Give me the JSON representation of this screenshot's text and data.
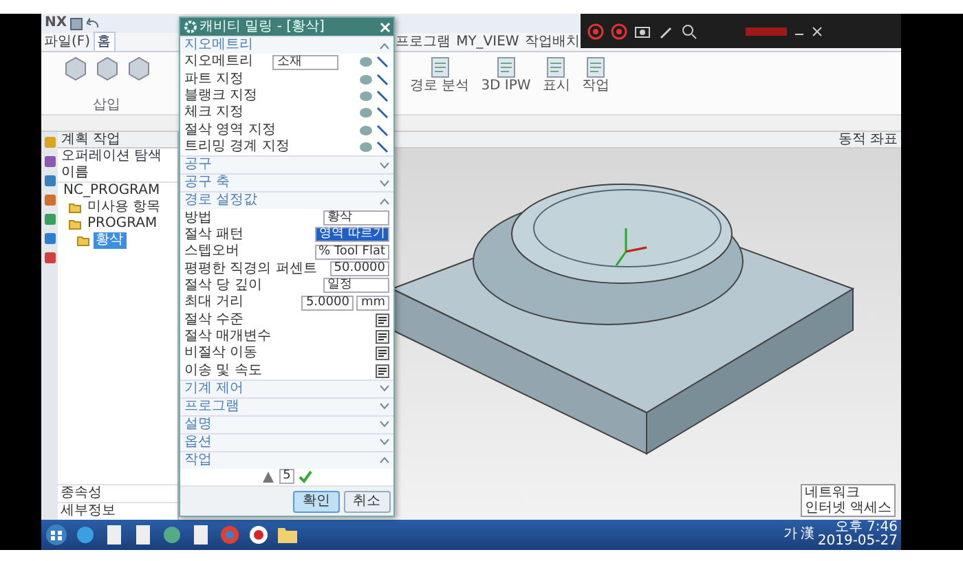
{
  "app": {
    "logo": "NX"
  },
  "ribbon": {
    "tabs": [
      {
        "label": "파일(F)",
        "selected": false
      },
      {
        "label": "홈",
        "selected": true
      },
      {
        "label": "프로그램",
        "selected": false
      },
      {
        "label": "MY_VIEW",
        "selected": false
      },
      {
        "label": "작업배치",
        "selected": false
      }
    ],
    "left_group": "삽입",
    "right_buttons": [
      {
        "label": "경로 분석"
      },
      {
        "label": "3D IPW"
      },
      {
        "label": "표시"
      },
      {
        "label": "작업"
      }
    ]
  },
  "navigator": {
    "title": "계획 작업",
    "header": "오퍼레이션 탐색",
    "column": "이름",
    "tree": [
      {
        "label": "NC_PROGRAM",
        "selected": false,
        "children": [
          {
            "label": "미사용 항목",
            "selected": false
          },
          {
            "label": "PROGRAM",
            "selected": false,
            "children": [
              {
                "label": "황삭",
                "selected": true
              }
            ]
          }
        ]
      }
    ],
    "footer": [
      {
        "label": "종속성"
      },
      {
        "label": "세부정보"
      }
    ]
  },
  "viewport": {
    "header": "동적 좌표"
  },
  "dialog": {
    "title": "캐비티 밀링 - [황삭]",
    "sections": [
      {
        "title": "지오메트리",
        "expanded": true,
        "rows": [
          {
            "kind": "select",
            "label": "지오메트리",
            "value": "소재"
          },
          {
            "kind": "geometry",
            "label": "파트 지정"
          },
          {
            "kind": "geometry",
            "label": "블랭크 지정"
          },
          {
            "kind": "geometry",
            "label": "체크 지정"
          },
          {
            "kind": "geometry",
            "label": "절삭 영역 지정"
          },
          {
            "kind": "geometry",
            "label": "트리밍 경계 지정"
          }
        ]
      },
      {
        "title": "공구",
        "expanded": false
      },
      {
        "title": "공구 축",
        "expanded": false
      },
      {
        "title": "경로 설정값",
        "expanded": true,
        "rows": [
          {
            "kind": "select",
            "label": "방법",
            "value": "황삭"
          },
          {
            "kind": "select",
            "label": "절삭 패턴",
            "value": "영역 따르기",
            "focused": true
          },
          {
            "kind": "select",
            "label": "스텝오버",
            "value": "% Tool Flat"
          },
          {
            "kind": "input",
            "label": "평평한 직경의 퍼센트",
            "value": "50.0000"
          },
          {
            "kind": "select",
            "label": "절삭 당 깊이",
            "value": "일정"
          },
          {
            "kind": "unit",
            "label": "최대 거리",
            "value": "5.0000",
            "unit": "mm"
          },
          {
            "kind": "action",
            "label": "절삭 수준"
          },
          {
            "kind": "action",
            "label": "절삭 매개변수"
          },
          {
            "kind": "action",
            "label": "비절삭 이동"
          },
          {
            "kind": "action",
            "label": "이송 및 속도"
          }
        ]
      },
      {
        "title": "기계 제어",
        "expanded": false
      },
      {
        "title": "프로그램",
        "expanded": false
      },
      {
        "title": "설명",
        "expanded": false
      },
      {
        "title": "옵션",
        "expanded": false
      },
      {
        "title": "작업",
        "expanded": true,
        "rows": [
          {
            "kind": "actions",
            "value": "5"
          }
        ]
      }
    ],
    "buttons": [
      {
        "label": "확인",
        "kind": "primary"
      },
      {
        "label": "취소",
        "kind": "secondary"
      }
    ]
  },
  "taskbar": {
    "ime": [
      "가",
      "漢"
    ],
    "time": "오후 7:46",
    "date": "2019-05-27",
    "tooltip": [
      "네트워크",
      "인터넷 액세스"
    ]
  }
}
